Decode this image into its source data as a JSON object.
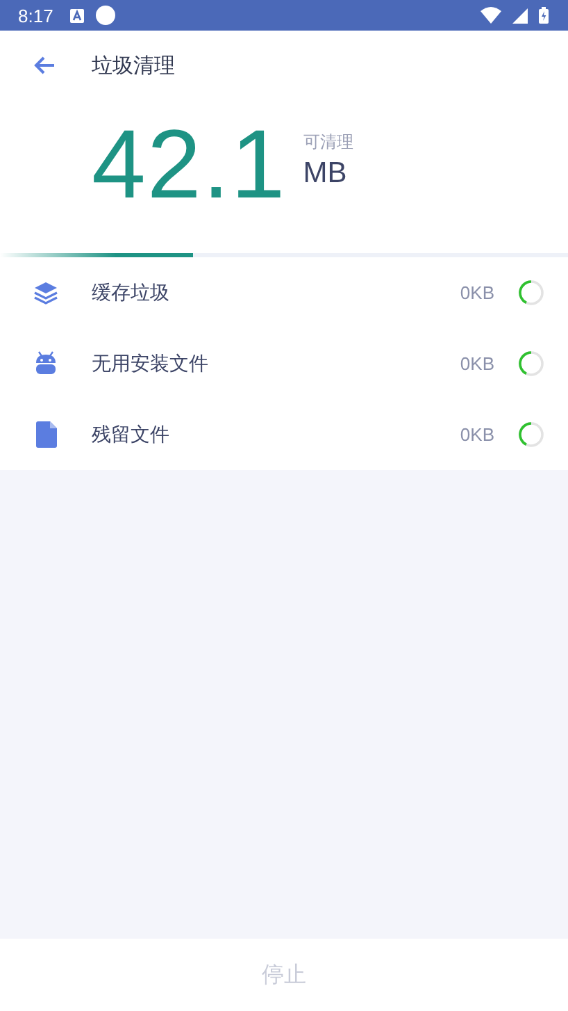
{
  "status_bar": {
    "time": "8:17"
  },
  "header": {
    "title": "垃圾清理"
  },
  "summary": {
    "amount": "42.1",
    "caption": "可清理",
    "unit": "MB"
  },
  "progress": {
    "level": 0.34
  },
  "items": [
    {
      "kind": "layers",
      "label": "缓存垃圾",
      "size": "0KB"
    },
    {
      "kind": "android",
      "label": "无用安装文件",
      "size": "0KB"
    },
    {
      "kind": "file",
      "label": "残留文件",
      "size": "0KB"
    }
  ],
  "stop_button": {
    "label": "停止",
    "disabled": true
  }
}
